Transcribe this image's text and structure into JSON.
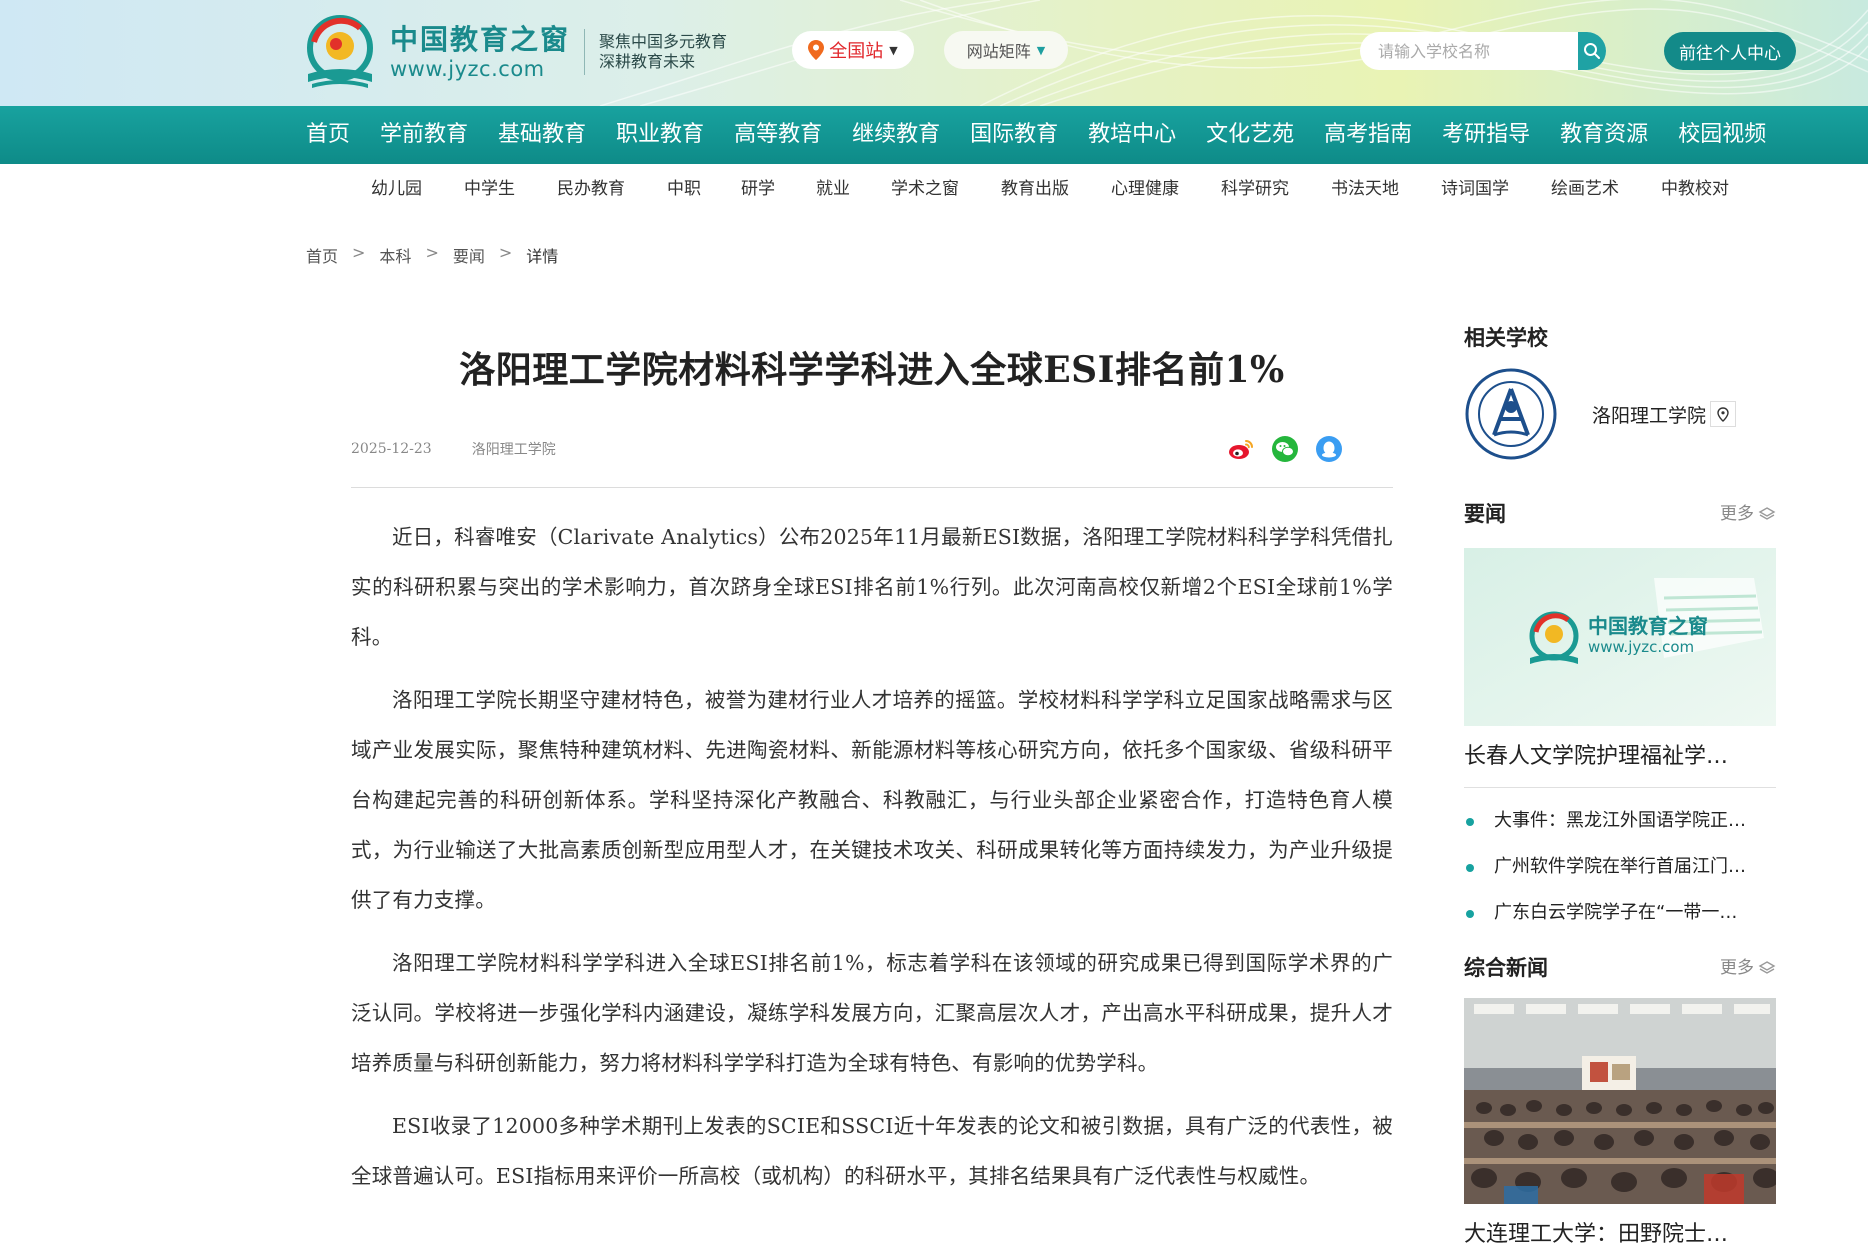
{
  "header": {
    "logo_cn": "中国教育之窗",
    "logo_url": "www.jyzc.com",
    "slogan_line1": "聚焦中国多元教育",
    "slogan_line2": "深耕教育未来",
    "site_selector": "全国站",
    "site_matrix": "网站矩阵",
    "search_placeholder": "请输入学校名称",
    "user_center": "前往个人中心",
    "accent_color": "#138a89",
    "location_color": "#e1262b"
  },
  "main_nav": [
    "首页",
    "学前教育",
    "基础教育",
    "职业教育",
    "高等教育",
    "继续教育",
    "国际教育",
    "教培中心",
    "文化艺苑",
    "高考指南",
    "考研指导",
    "教育资源",
    "校园视频"
  ],
  "sub_nav": [
    "幼儿园",
    "中学生",
    "民办教育",
    "中职",
    "研学",
    "就业",
    "学术之窗",
    "教育出版",
    "心理健康",
    "科学研究",
    "书法天地",
    "诗词国学",
    "绘画艺术",
    "中教校对"
  ],
  "breadcrumb": [
    "首页",
    "本科",
    "要闻",
    "详情"
  ],
  "breadcrumb_sep": ">",
  "article": {
    "title": "洛阳理工学院材料科学学科进入全球ESI排名前1%",
    "date": "2025-12-23",
    "source": "洛阳理工学院",
    "share_icons": [
      "weibo-icon",
      "wechat-icon",
      "qq-icon"
    ],
    "paragraphs": [
      "近日，科睿唯安（Clarivate Analytics）公布2025年11月最新ESI数据，洛阳理工学院材料科学学科凭借扎实的科研积累与突出的学术影响力，首次跻身全球ESI排名前1%行列。此次河南高校仅新增2个ESI全球前1%学科。",
      "洛阳理工学院长期坚守建材特色，被誉为建材行业人才培养的摇篮。学校材料科学学科立足国家战略需求与区域产业发展实际，聚焦特种建筑材料、先进陶瓷材料、新能源材料等核心研究方向，依托多个国家级、省级科研平台构建起完善的科研创新体系。学科坚持深化产教融合、科教融汇，与行业头部企业紧密合作，打造特色育人模式，为行业输送了大批高素质创新型应用型人才，在关键技术攻关、科研成果转化等方面持续发力，为产业升级提供了有力支撑。",
      "洛阳理工学院材料科学学科进入全球ESI排名前1%，标志着学科在该领域的研究成果已得到国际学术界的广泛认同。学校将进一步强化学科内涵建设，凝练学科发展方向，汇聚高层次人才，产出高水平科研成果，提升人才培养质量与科研创新能力，努力将材料科学学科打造为全球有特色、有影响的优势学科。",
      "ESI收录了12000多种学术期刊上发表的SCIE和SSCI近十年发表的论文和被引数据，具有广泛的代表性，被全球普遍认可。ESI指标用来评价一所高校（或机构）的科研水平，其排名结果具有广泛代表性与权威性。"
    ]
  },
  "sidebar": {
    "related_school_heading": "相关学校",
    "school_name": "洛阳理工学院",
    "news_heading": "要闻",
    "more_label": "更多",
    "placeholder_logo_cn": "中国教育之窗",
    "placeholder_logo_url": "www.jyzc.com",
    "feature_title": "长春人文学院护理福祉学…",
    "news_items": [
      "大事件：黑龙江外国语学院正…",
      "广州软件学院在举行首届江门…",
      "广东白云学院学子在“一带一…"
    ],
    "general_heading": "综合新闻",
    "general_feature_title": "大连理工大学：田野院士…"
  }
}
